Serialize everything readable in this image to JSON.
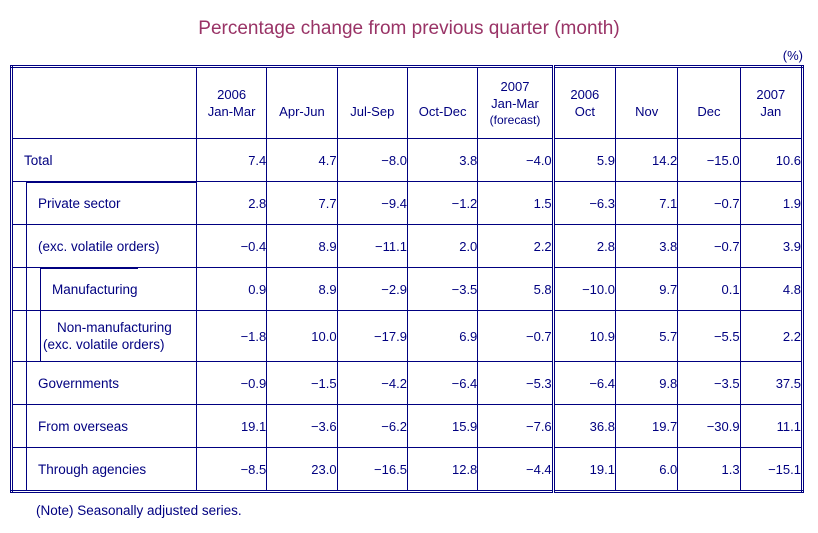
{
  "title": "Percentage change from previous quarter (month)",
  "unit": "(%)",
  "note": "(Note) Seasonally adjusted series.",
  "colors": {
    "title": "#993366",
    "border": "#000080",
    "label_text": "#000080",
    "value_text": "#008000",
    "background": "#ffffff"
  },
  "table": {
    "corner_header": "",
    "quarter_columns": [
      {
        "year": "2006",
        "period": "Jan-Mar",
        "forecast": ""
      },
      {
        "year": "",
        "period": "Apr-Jun",
        "forecast": ""
      },
      {
        "year": "",
        "period": "Jul-Sep",
        "forecast": ""
      },
      {
        "year": "",
        "period": "Oct-Dec",
        "forecast": ""
      },
      {
        "year": "2007",
        "period": "Jan-Mar",
        "forecast": "(forecast)"
      }
    ],
    "month_columns": [
      {
        "year": "2006",
        "period": "Oct"
      },
      {
        "year": "",
        "period": "Nov"
      },
      {
        "year": "",
        "period": "Dec"
      },
      {
        "year": "2007",
        "period": "Jan"
      }
    ],
    "rows": [
      {
        "label": "Total",
        "label_line2": "",
        "indent": 0,
        "values": [
          "7.4",
          "4.7",
          "−8.0",
          "3.8",
          "−4.0",
          "5.9",
          "14.2",
          "−15.0",
          "10.6"
        ]
      },
      {
        "label": "Private sector",
        "label_line2": "",
        "indent": 1,
        "values": [
          "2.8",
          "7.7",
          "−9.4",
          "−1.2",
          "1.5",
          "−6.3",
          "7.1",
          "−0.7",
          "1.9"
        ]
      },
      {
        "label": "(exc. volatile orders)",
        "label_line2": "",
        "indent": 1,
        "values": [
          "−0.4",
          "8.9",
          "−11.1",
          "2.0",
          "2.2",
          "2.8",
          "3.8",
          "−0.7",
          "3.9"
        ]
      },
      {
        "label": "Manufacturing",
        "label_line2": "",
        "indent": 2,
        "values": [
          "0.9",
          "8.9",
          "−2.9",
          "−3.5",
          "5.8",
          "−10.0",
          "9.7",
          "0.1",
          "4.8"
        ]
      },
      {
        "label": "Non-manufacturing",
        "label_line2": "(exc. volatile orders)",
        "indent": 2,
        "values": [
          "−1.8",
          "10.0",
          "−17.9",
          "6.9",
          "−0.7",
          "10.9",
          "5.7",
          "−5.5",
          "2.2"
        ]
      },
      {
        "label": "Governments",
        "label_line2": "",
        "indent": 1,
        "values": [
          "−0.9",
          "−1.5",
          "−4.2",
          "−6.4",
          "−5.3",
          "−6.4",
          "9.8",
          "−3.5",
          "37.5"
        ]
      },
      {
        "label": "From overseas",
        "label_line2": "",
        "indent": 1,
        "values": [
          "19.1",
          "−3.6",
          "−6.2",
          "15.9",
          "−7.6",
          "36.8",
          "19.7",
          "−30.9",
          "11.1"
        ]
      },
      {
        "label": "Through agencies",
        "label_line2": "",
        "indent": 1,
        "values": [
          "−8.5",
          "23.0",
          "−16.5",
          "12.8",
          "−4.4",
          "19.1",
          "6.0",
          "1.3",
          "−15.1"
        ]
      }
    ]
  }
}
